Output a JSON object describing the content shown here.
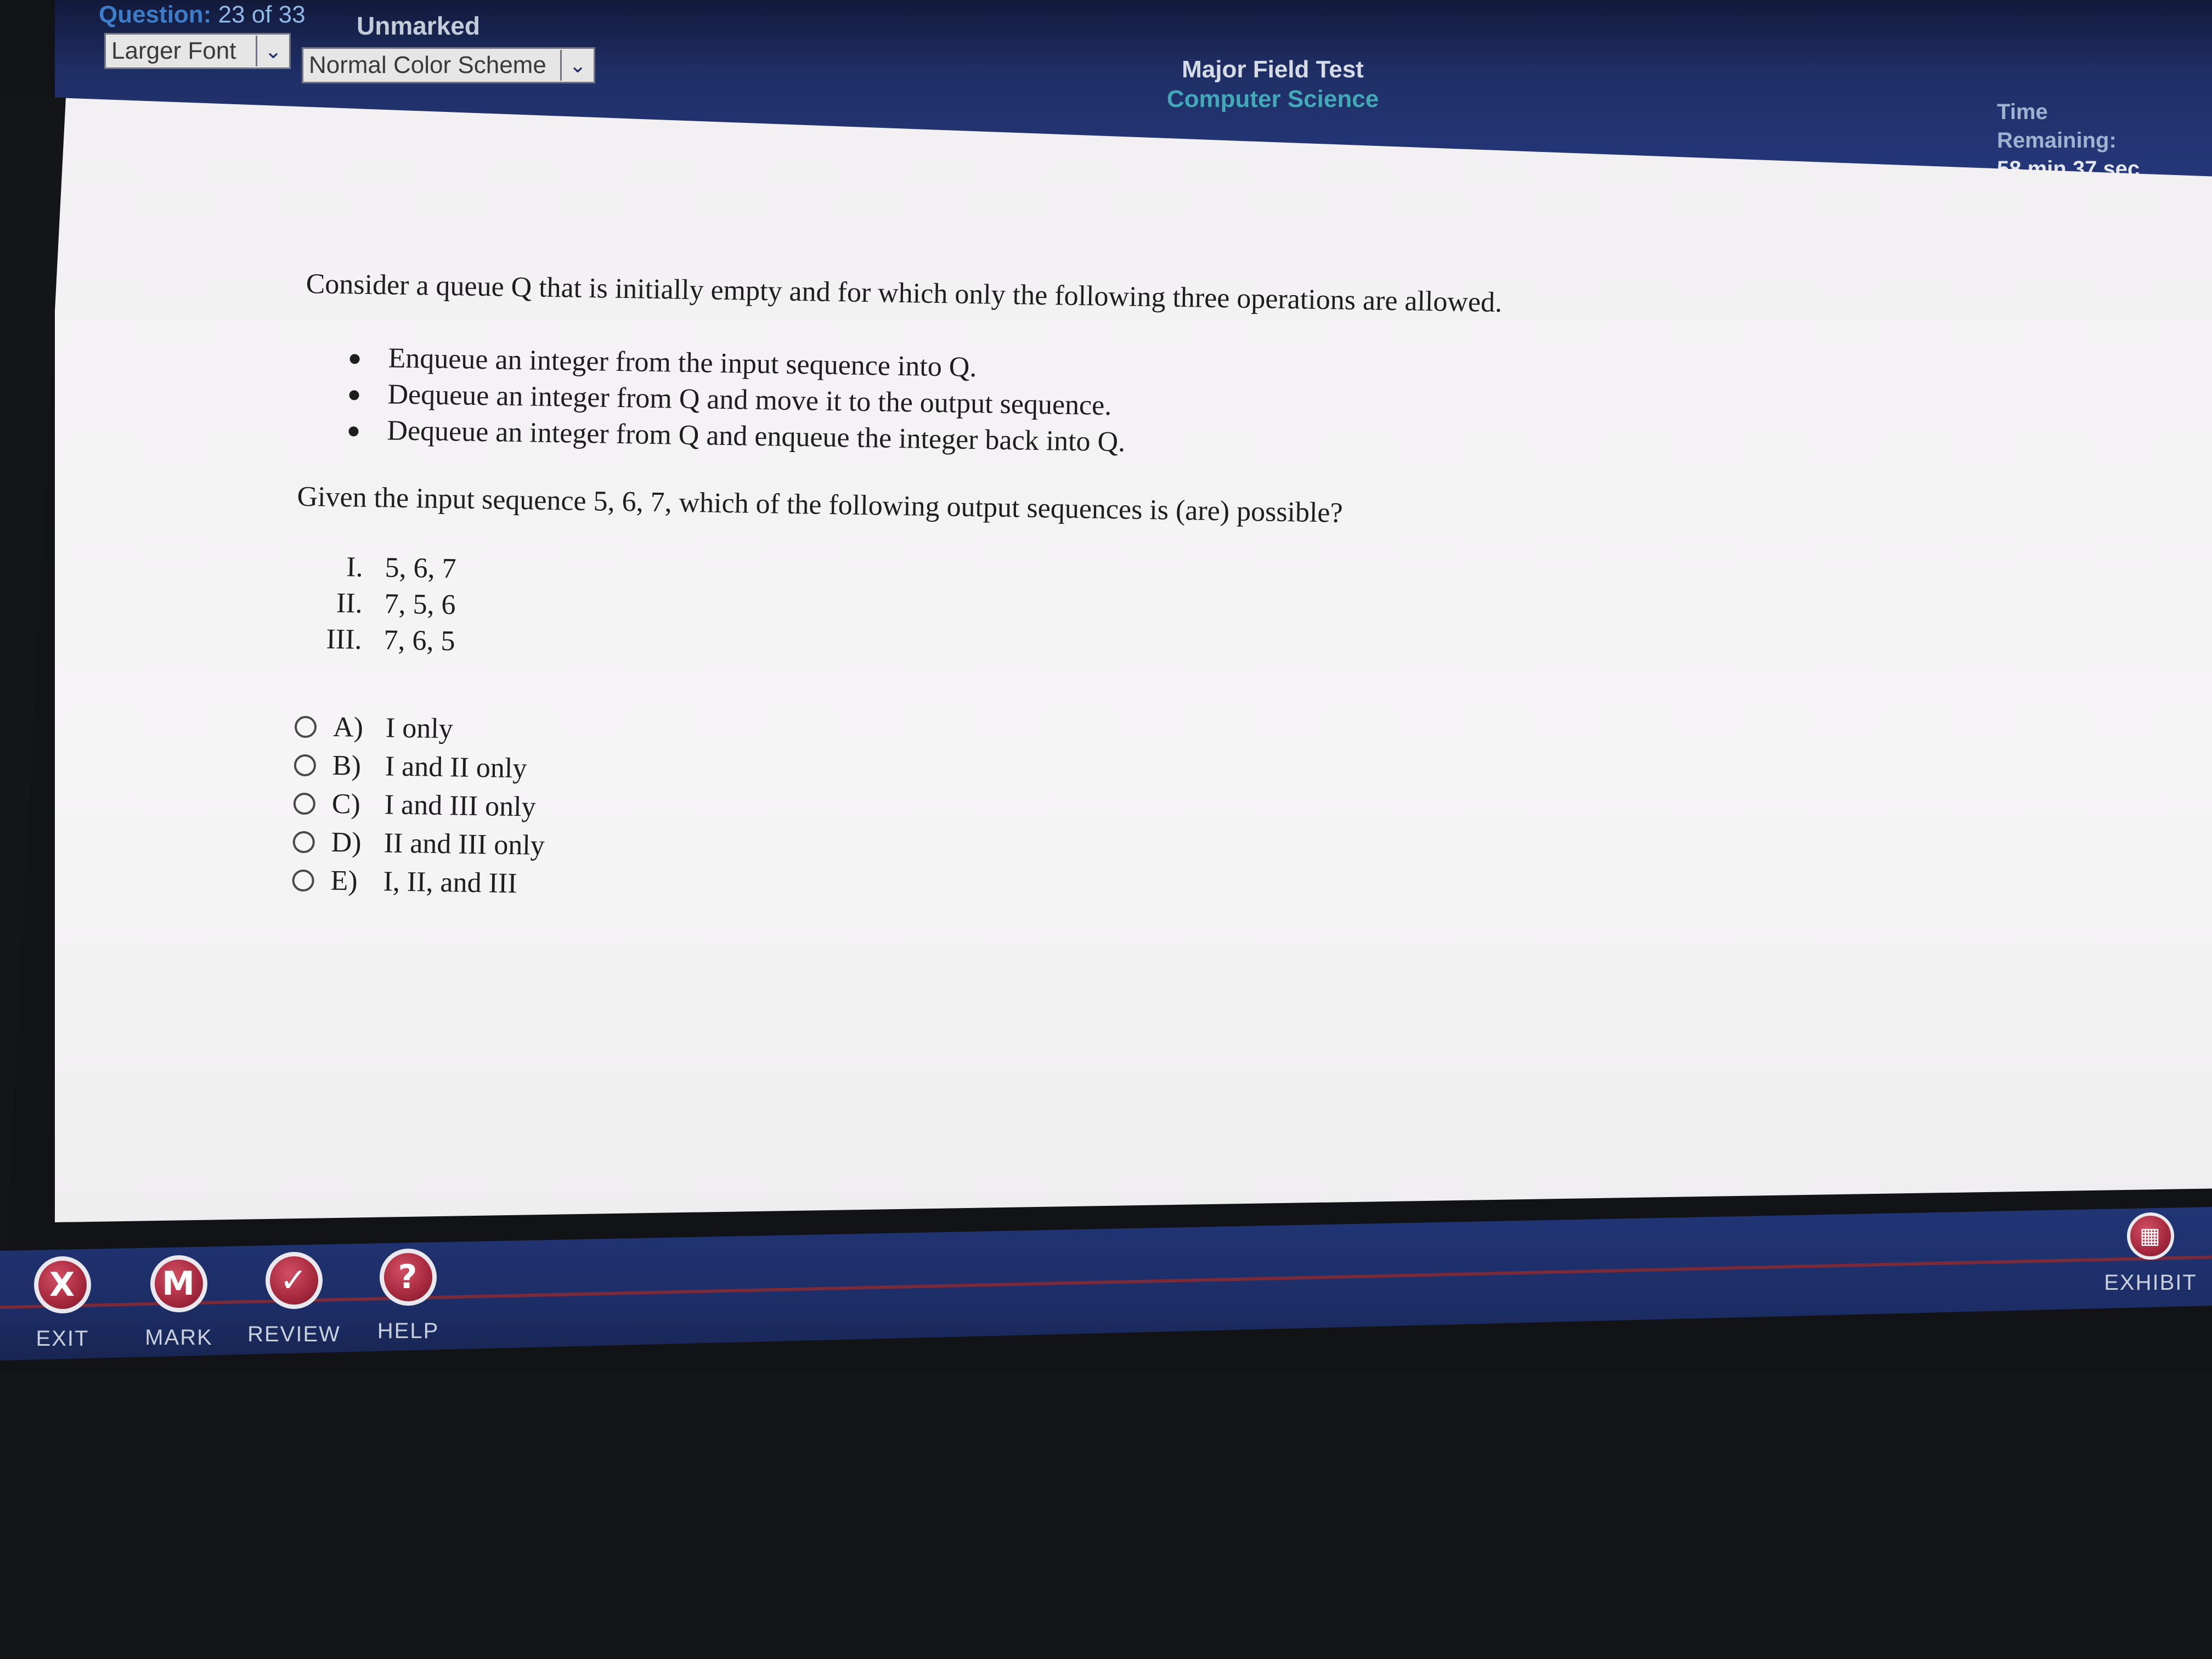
{
  "header": {
    "question_label": "Question:",
    "question_position": "23 of 33",
    "mark_status": "Unmarked",
    "font_select": "Larger Font",
    "color_select": "Normal Color Scheme",
    "test_name": "Major Field Test",
    "test_subject": "Computer Science",
    "time_label": "Time Remaining:",
    "time_value": "58 min 37 sec"
  },
  "question": {
    "stem": "Consider a queue Q that is initially empty and for which only the following three operations are allowed.",
    "operations": [
      "Enqueue an integer from the input sequence into Q.",
      "Dequeue an integer from Q and move it to the output sequence.",
      "Dequeue an integer from Q and enqueue the integer back into Q."
    ],
    "prompt": "Given the input sequence 5, 6, 7, which of the following output sequences is (are) possible?",
    "sequences": [
      {
        "numeral": "I.",
        "value": "5, 6, 7"
      },
      {
        "numeral": "II.",
        "value": "7, 5, 6"
      },
      {
        "numeral": "III.",
        "value": "7, 6, 5"
      }
    ],
    "choices": [
      {
        "letter": "A)",
        "text": "I only"
      },
      {
        "letter": "B)",
        "text": "I and II only"
      },
      {
        "letter": "C)",
        "text": "I and III only"
      },
      {
        "letter": "D)",
        "text": "II and III only"
      },
      {
        "letter": "E)",
        "text": "I, II, and III"
      }
    ]
  },
  "toolbar": {
    "exit_label": "EXIT",
    "exit_glyph": "X",
    "mark_label": "MARK",
    "mark_glyph": "M",
    "review_label": "REVIEW",
    "review_glyph": "✓",
    "help_label": "HELP",
    "help_glyph": "?",
    "exhibit_label": "EXHIBIT",
    "exhibit_icon": "exhibit-icon"
  },
  "colors": {
    "header_blue": "#24377a",
    "button_red": "#a5283d",
    "subject_teal": "#43a9b6"
  }
}
